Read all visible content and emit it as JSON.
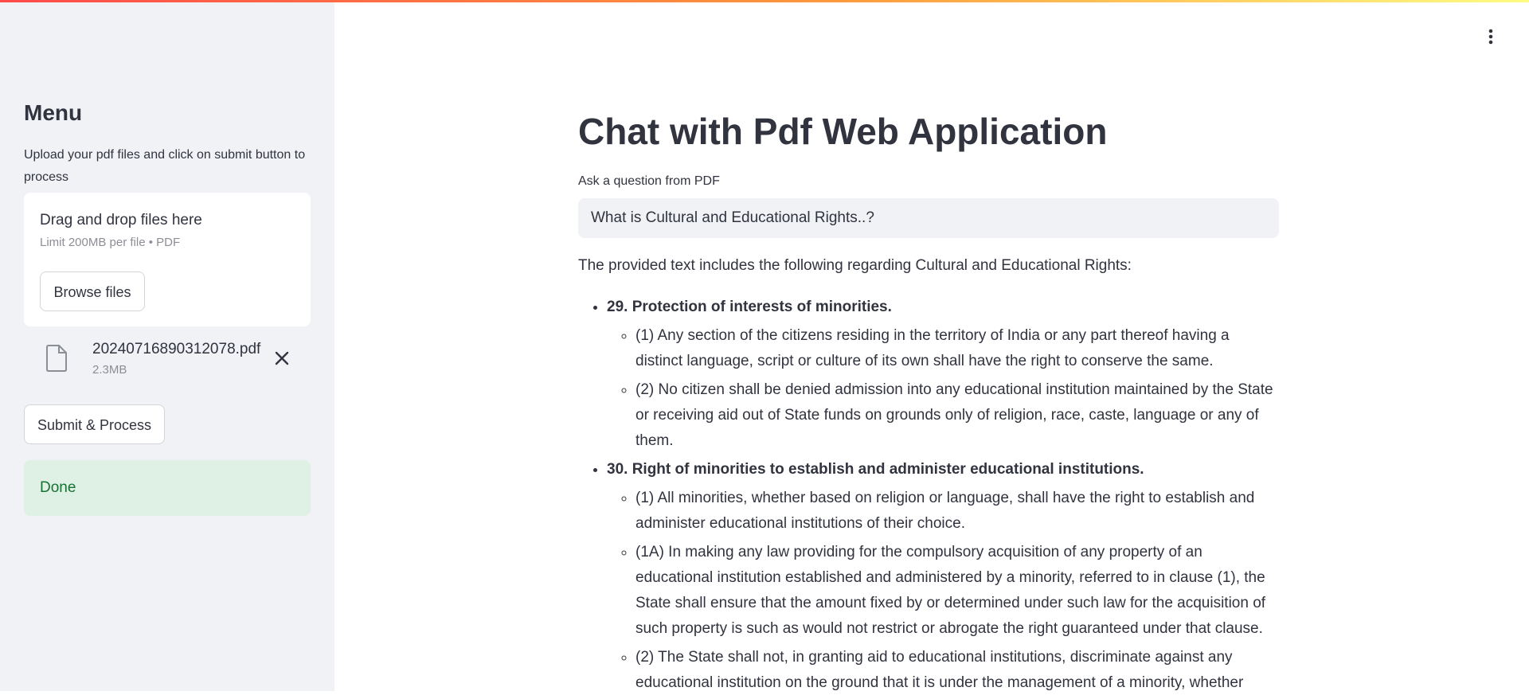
{
  "sidebar": {
    "title": "Menu",
    "description": "Upload your pdf files and click on submit button to process",
    "uploader": {
      "title": "Drag and drop files here",
      "limit": "Limit 200MB per file • PDF",
      "browse_label": "Browse files"
    },
    "file": {
      "name": "20240716890312078.pdf",
      "size": "2.3MB",
      "icon": "file-icon",
      "remove_icon": "close-icon"
    },
    "submit_label": "Submit & Process",
    "status": "Done"
  },
  "header": {
    "menu_icon": "kebab-menu-icon"
  },
  "main": {
    "title": "Chat with Pdf Web Application",
    "question_label": "Ask a question from PDF",
    "question_value": "What is Cultural and Educational Rights..?",
    "answer_intro": "The provided text includes the following regarding Cultural and Educational Rights:",
    "sections": [
      {
        "heading": "29. Protection of interests of minorities.",
        "items": [
          "(1) Any section of the citizens residing in the territory of India or any part thereof having a distinct language, script or culture of its own shall have the right to conserve the same.",
          "(2) No citizen shall be denied admission into any educational institution maintained by the State or receiving aid out of State funds on grounds only of religion, race, caste, language or any of them."
        ]
      },
      {
        "heading": "30. Right of minorities to establish and administer educational institutions.",
        "items": [
          "(1) All minorities, whether based on religion or language, shall have the right to establish and administer educational institutions of their choice.",
          "(1A) In making any law providing for the compulsory acquisition of any property of an educational institution established and administered by a minority, referred to in clause (1), the State shall ensure that the amount fixed by or determined under such law for the acquisition of such property is such as would not restrict or abrogate the right guaranteed under that clause.",
          "(2) The State shall not, in granting aid to educational institutions, discriminate against any educational institution on the ground that it is under the management of a minority, whether"
        ]
      }
    ]
  },
  "colors": {
    "sidebar_bg": "#f0f2f6",
    "text": "#31333f",
    "success_bg": "#dff0e5",
    "success_text": "#177233",
    "muted": "#8c8e96"
  }
}
